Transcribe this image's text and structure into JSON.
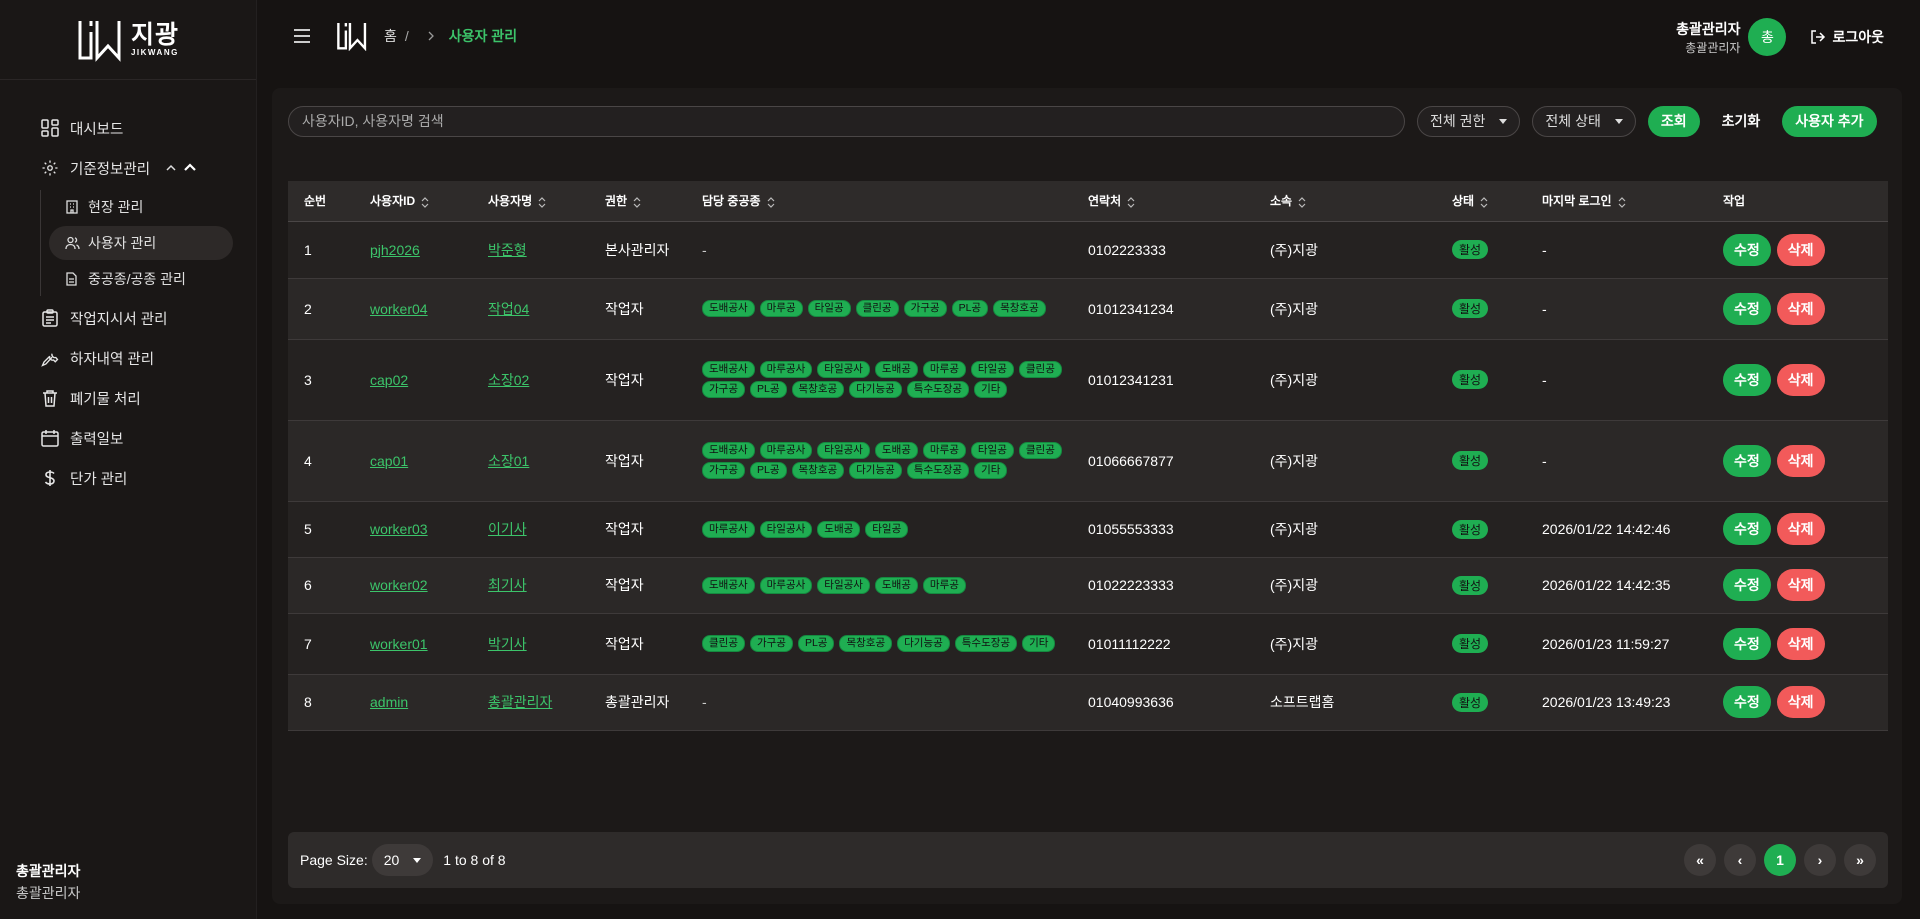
{
  "app": {
    "logo_kr": "지광",
    "logo_en": "JIKWANG"
  },
  "sidebar": {
    "items": [
      {
        "label": "대시보드",
        "icon": "dashboard-icon"
      },
      {
        "label": "기준정보관리",
        "icon": "gear-icon",
        "expanded": true
      },
      {
        "label": "작업지시서 관리",
        "icon": "clipboard-icon"
      },
      {
        "label": "하자내역 관리",
        "icon": "wrench-icon"
      },
      {
        "label": "폐기물 처리",
        "icon": "trash-icon"
      },
      {
        "label": "출력일보",
        "icon": "calendar-icon"
      },
      {
        "label": "단가 관리",
        "icon": "dollar-icon"
      }
    ],
    "subitems": [
      {
        "label": "현장 관리",
        "icon": "building-icon"
      },
      {
        "label": "사용자 관리",
        "icon": "users-icon",
        "active": true
      },
      {
        "label": "중공종/공종 관리",
        "icon": "document-icon"
      }
    ],
    "footer": {
      "name": "총괄관리자",
      "role": "총괄관리자"
    }
  },
  "header": {
    "breadcrumb_home": "홈",
    "breadcrumb_sep": "/",
    "breadcrumb_current": "사용자 관리",
    "user_name": "총괄관리자",
    "user_role": "총괄관리자",
    "avatar_initial": "총",
    "logout_label": "로그아웃"
  },
  "toolbar": {
    "search_placeholder": "사용자ID, 사용자명 검색",
    "role_filter": "전체 권한",
    "status_filter": "전체 상태",
    "search_button": "조회",
    "reset_button": "초기화",
    "add_button": "사용자 추가"
  },
  "table": {
    "columns": [
      "순번",
      "사용자ID",
      "사용자명",
      "권한",
      "담당 중공종",
      "연락처",
      "소속",
      "상태",
      "마지막 로그인",
      "작업"
    ],
    "edit_label": "수정",
    "delete_label": "삭제",
    "rows": [
      {
        "no": "1",
        "id": "pjh2026",
        "name": "박준형",
        "role": "본사관리자",
        "trades": [],
        "phone": "0102223333",
        "org": "(주)지광",
        "status": "활성",
        "last_login": "-"
      },
      {
        "no": "2",
        "id": "worker04",
        "name": "작업04",
        "role": "작업자",
        "trades": [
          "도배공사",
          "마루공",
          "타일공",
          "클린공",
          "가구공",
          "PL공",
          "목창호공"
        ],
        "phone": "01012341234",
        "org": "(주)지광",
        "status": "활성",
        "last_login": "-"
      },
      {
        "no": "3",
        "id": "cap02",
        "name": "소장02",
        "role": "작업자",
        "trades": [
          "도배공사",
          "마루공사",
          "타일공사",
          "도배공",
          "마루공",
          "타일공",
          "클린공",
          "가구공",
          "PL공",
          "목창호공",
          "다기능공",
          "특수도장공",
          "기타"
        ],
        "phone": "01012341231",
        "org": "(주)지광",
        "status": "활성",
        "last_login": "-"
      },
      {
        "no": "4",
        "id": "cap01",
        "name": "소장01",
        "role": "작업자",
        "trades": [
          "도배공사",
          "마루공사",
          "타일공사",
          "도배공",
          "마루공",
          "타일공",
          "클린공",
          "가구공",
          "PL공",
          "목창호공",
          "다기능공",
          "특수도장공",
          "기타"
        ],
        "phone": "01066667877",
        "org": "(주)지광",
        "status": "활성",
        "last_login": "-"
      },
      {
        "no": "5",
        "id": "worker03",
        "name": "이기사",
        "role": "작업자",
        "trades": [
          "마루공사",
          "타일공사",
          "도배공",
          "타일공"
        ],
        "phone": "01055553333",
        "org": "(주)지광",
        "status": "활성",
        "last_login": "2026/01/22 14:42:46"
      },
      {
        "no": "6",
        "id": "worker02",
        "name": "최기사",
        "role": "작업자",
        "trades": [
          "도배공사",
          "마루공사",
          "타일공사",
          "도배공",
          "마루공"
        ],
        "phone": "01022223333",
        "org": "(주)지광",
        "status": "활성",
        "last_login": "2026/01/22 14:42:35"
      },
      {
        "no": "7",
        "id": "worker01",
        "name": "박기사",
        "role": "작업자",
        "trades": [
          "클린공",
          "가구공",
          "PL공",
          "목창호공",
          "다기능공",
          "특수도장공",
          "기타"
        ],
        "phone": "01011112222",
        "org": "(주)지광",
        "status": "활성",
        "last_login": "2026/01/23 11:59:27"
      },
      {
        "no": "8",
        "id": "admin",
        "name": "총괄관리자",
        "role": "총괄관리자",
        "trades": [],
        "phone": "01040993636",
        "org": "소프트랩홈",
        "status": "활성",
        "last_login": "2026/01/23 13:49:23"
      }
    ]
  },
  "pagination": {
    "page_size_label": "Page Size:",
    "page_size": "20",
    "range_text": "1 to 8 of 8",
    "first": "«",
    "prev": "‹",
    "current": "1",
    "next": "›",
    "last": "»"
  },
  "colors": {
    "accent": "#1fae52",
    "danger": "#f25a5a",
    "background": "#161312"
  }
}
